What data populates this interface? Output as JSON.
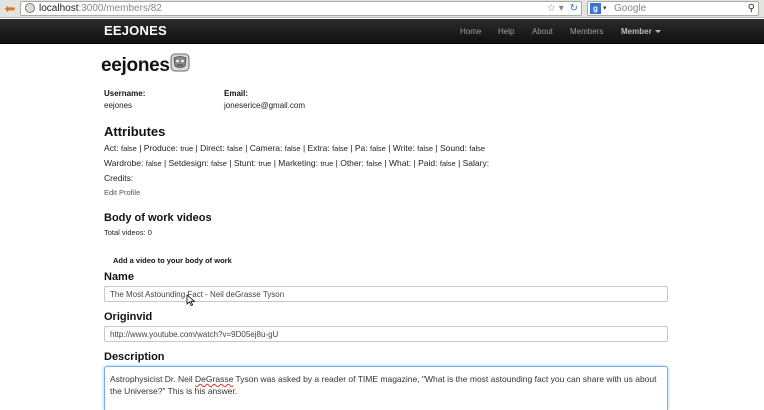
{
  "browser": {
    "url_host": "localhost",
    "url_path": ":3000/members/82",
    "search_placeholder": "Google"
  },
  "navbar": {
    "brand": "EEJONES",
    "items": [
      "Home",
      "Help",
      "About",
      "Members",
      "Member"
    ]
  },
  "profile": {
    "name": "eejones",
    "username_label": "Username:",
    "username": "eejones",
    "email_label": "Email:",
    "email": "joneserice@gmail.com"
  },
  "attributes": {
    "heading": "Attributes",
    "line1": [
      {
        "k": "Act:",
        "v": "false"
      },
      {
        "k": "Produce:",
        "v": "true"
      },
      {
        "k": "Direct:",
        "v": "false"
      },
      {
        "k": "Camera:",
        "v": "false"
      },
      {
        "k": "Extra:",
        "v": "false"
      },
      {
        "k": "Pa:",
        "v": "false"
      },
      {
        "k": "Write:",
        "v": "false"
      },
      {
        "k": "Sound:",
        "v": "false"
      }
    ],
    "line2": [
      {
        "k": "Wardrobe:",
        "v": "false"
      },
      {
        "k": "Setdesign:",
        "v": "false"
      },
      {
        "k": "Stunt:",
        "v": "true"
      },
      {
        "k": "Marketing:",
        "v": "true"
      },
      {
        "k": "Other:",
        "v": "false"
      },
      {
        "k": "What:",
        "v": ""
      },
      {
        "k": "Paid:",
        "v": "false"
      },
      {
        "k": "Salary:",
        "v": ""
      }
    ],
    "credits_label": "Credits:",
    "edit_profile": "Edit Profile"
  },
  "videos": {
    "heading": "Body of work videos",
    "total": "Total videos: 0",
    "add_label": "Add a video to your body of work"
  },
  "form": {
    "name_label": "Name",
    "name_value": "The Most Astounding Fact - Neil deGrasse Tyson",
    "originvid_label": "Originvid",
    "originvid_value": "http://www.youtube.com/watch?v=9D05ej8u-gU",
    "description_label": "Description",
    "description_before": "Astrophysicist Dr. Neil ",
    "description_misspelled": "DeGrasse",
    "description_after": " Tyson was asked by a reader of TIME magazine, \"What is the most astounding fact you can share with us about the Universe?\" This is his answer."
  }
}
